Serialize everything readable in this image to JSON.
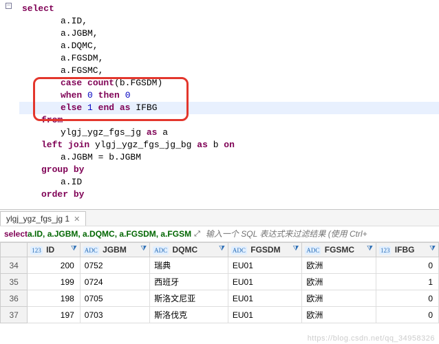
{
  "editor": {
    "fold_symbol": "−",
    "lines": [
      {
        "indent": 0,
        "highlighted": false,
        "tokens": [
          {
            "t": "kw",
            "v": "select"
          }
        ]
      },
      {
        "indent": 2,
        "highlighted": false,
        "tokens": [
          {
            "t": "ident",
            "v": "a.ID,"
          }
        ]
      },
      {
        "indent": 2,
        "highlighted": false,
        "tokens": [
          {
            "t": "ident",
            "v": "a.JGBM,"
          }
        ]
      },
      {
        "indent": 2,
        "highlighted": false,
        "tokens": [
          {
            "t": "ident",
            "v": "a.DQMC,"
          }
        ]
      },
      {
        "indent": 2,
        "highlighted": false,
        "tokens": [
          {
            "t": "ident",
            "v": "a.FGSDM,"
          }
        ]
      },
      {
        "indent": 2,
        "highlighted": false,
        "tokens": [
          {
            "t": "ident",
            "v": "a.FGSMC,"
          }
        ]
      },
      {
        "indent": 2,
        "highlighted": false,
        "tokens": [
          {
            "t": "kw",
            "v": "case"
          },
          {
            "t": "ident",
            "v": " "
          },
          {
            "t": "kw",
            "v": "count"
          },
          {
            "t": "ident",
            "v": "(b.FGSDM)"
          }
        ]
      },
      {
        "indent": 2,
        "highlighted": false,
        "tokens": [
          {
            "t": "kw",
            "v": "when"
          },
          {
            "t": "ident",
            "v": " "
          },
          {
            "t": "num",
            "v": "0"
          },
          {
            "t": "ident",
            "v": " "
          },
          {
            "t": "kw",
            "v": "then"
          },
          {
            "t": "ident",
            "v": " "
          },
          {
            "t": "num",
            "v": "0"
          }
        ]
      },
      {
        "indent": 2,
        "highlighted": true,
        "tokens": [
          {
            "t": "kw",
            "v": "else"
          },
          {
            "t": "ident",
            "v": " "
          },
          {
            "t": "num",
            "v": "1"
          },
          {
            "t": "ident",
            "v": " "
          },
          {
            "t": "kw",
            "v": "end"
          },
          {
            "t": "ident",
            "v": " "
          },
          {
            "t": "kw",
            "v": "as"
          },
          {
            "t": "ident",
            "v": " IFBG"
          }
        ]
      },
      {
        "indent": 1,
        "highlighted": false,
        "tokens": [
          {
            "t": "kw",
            "v": "from"
          }
        ]
      },
      {
        "indent": 2,
        "highlighted": false,
        "tokens": [
          {
            "t": "ident",
            "v": "ylgj_ygz_fgs_jg "
          },
          {
            "t": "kw",
            "v": "as"
          },
          {
            "t": "ident",
            "v": " a"
          }
        ]
      },
      {
        "indent": 1,
        "highlighted": false,
        "tokens": [
          {
            "t": "kw",
            "v": "left"
          },
          {
            "t": "ident",
            "v": " "
          },
          {
            "t": "kw",
            "v": "join"
          },
          {
            "t": "ident",
            "v": " ylgj_ygz_fgs_jg_bg "
          },
          {
            "t": "kw",
            "v": "as"
          },
          {
            "t": "ident",
            "v": " b "
          },
          {
            "t": "kw",
            "v": "on"
          }
        ]
      },
      {
        "indent": 2,
        "highlighted": false,
        "tokens": [
          {
            "t": "ident",
            "v": "a.JGBM = b.JGBM"
          }
        ]
      },
      {
        "indent": 1,
        "highlighted": false,
        "tokens": [
          {
            "t": "kw",
            "v": "group"
          },
          {
            "t": "ident",
            "v": " "
          },
          {
            "t": "kw",
            "v": "by"
          }
        ]
      },
      {
        "indent": 2,
        "highlighted": false,
        "tokens": [
          {
            "t": "ident",
            "v": "a.ID"
          }
        ]
      },
      {
        "indent": 1,
        "highlighted": false,
        "tokens": [
          {
            "t": "kw",
            "v": "order"
          },
          {
            "t": "ident",
            "v": " "
          },
          {
            "t": "kw",
            "v": "by"
          }
        ]
      }
    ]
  },
  "tab": {
    "label": "ylgj_ygz_fgs_jg 1",
    "close": "✕"
  },
  "sqlrow": {
    "kw": "select",
    "rest": " a.ID, a.JGBM, a.DQMC, a.FGSDM, a.FGSM",
    "expand": "⤢",
    "placeholder": "输入一个 SQL 表达式来过滤结果 (使用 Ctrl+"
  },
  "columns": [
    {
      "type": "123",
      "label": "ID"
    },
    {
      "type": "ADC",
      "label": "JGBM"
    },
    {
      "type": "ADC",
      "label": "DQMC"
    },
    {
      "type": "ADC",
      "label": "FGSDM"
    },
    {
      "type": "ADC",
      "label": "FGSMC"
    },
    {
      "type": "123",
      "label": "IFBG"
    }
  ],
  "rows": [
    {
      "n": "34",
      "ID": "200",
      "JGBM": "0752",
      "DQMC": "瑞典",
      "FGSDM": "EU01",
      "FGSMC": "欧洲",
      "IFBG": "0"
    },
    {
      "n": "35",
      "ID": "199",
      "JGBM": "0724",
      "DQMC": "西班牙",
      "FGSDM": "EU01",
      "FGSMC": "欧洲",
      "IFBG": "1"
    },
    {
      "n": "36",
      "ID": "198",
      "JGBM": "0705",
      "DQMC": "斯洛文尼亚",
      "FGSDM": "EU01",
      "FGSMC": "欧洲",
      "IFBG": "0"
    },
    {
      "n": "37",
      "ID": "197",
      "JGBM": "0703",
      "DQMC": "斯洛伐克",
      "FGSDM": "EU01",
      "FGSMC": "欧洲",
      "IFBG": "0"
    }
  ],
  "filter_glyph": "⧩",
  "watermark": "https://blog.csdn.net/qq_34958326"
}
